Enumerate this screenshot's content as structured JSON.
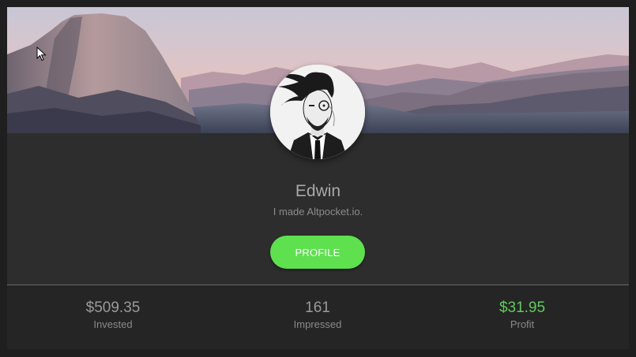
{
  "user": {
    "name": "Edwin",
    "bio": "I made Altpocket.io."
  },
  "buttons": {
    "profile_label": "PROFILE"
  },
  "stats": [
    {
      "value": "$509.35",
      "label": "Invested"
    },
    {
      "value": "161",
      "label": "Impressed"
    },
    {
      "value": "$31.95",
      "label": "Profit"
    }
  ],
  "colors": {
    "accent_green": "#5ee04f",
    "profit_green": "#5ecb5a",
    "card_background": "#2d2d2d"
  },
  "icons": {
    "cursor": "mouse-pointer-icon"
  }
}
